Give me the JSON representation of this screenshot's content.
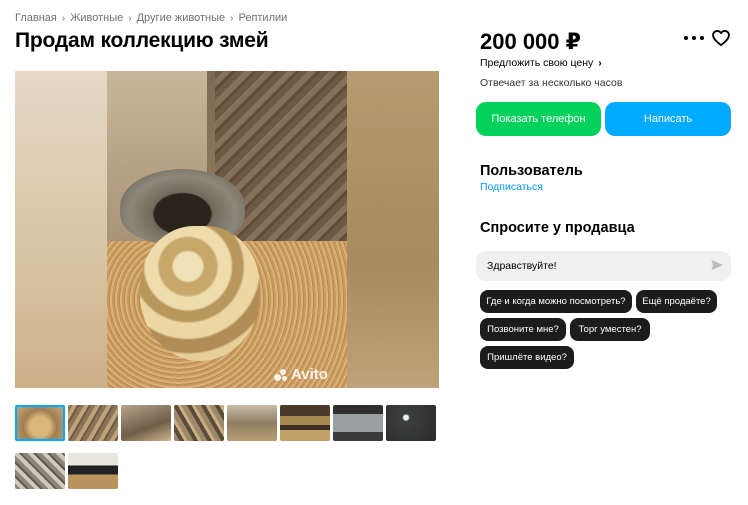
{
  "breadcrumb": [
    "Главная",
    "Животные",
    "Другие животные",
    "Рептилии"
  ],
  "listing": {
    "title": "Продам коллекцию змей",
    "price": "200 000 ₽",
    "offer_price_link": "Предложить свою цену",
    "response_time": "Отвечает за несколько часов"
  },
  "photo": {
    "watermark": "Avito",
    "thumbnail_count": 10
  },
  "actions": {
    "show_phone": "Показать телефон",
    "write": "Написать"
  },
  "seller": {
    "name": "Пользователь",
    "subscribe": "Подписаться"
  },
  "ask": {
    "title": "Спросите у продавца",
    "input_value": "Здравствуйте!",
    "quick_questions": [
      "Где и когда можно посмотреть?",
      "Ещё продаёте?",
      "Позвоните мне?",
      "Торг уместен?",
      "Пришлёте видео?"
    ]
  },
  "colors": {
    "phone_button": "#02d15c",
    "write_button": "#00aaff",
    "link": "#0099f7",
    "chip": "#1c1c1c"
  },
  "icons": [
    "more-icon",
    "heart-icon",
    "send-icon",
    "chevron-right-icon"
  ]
}
